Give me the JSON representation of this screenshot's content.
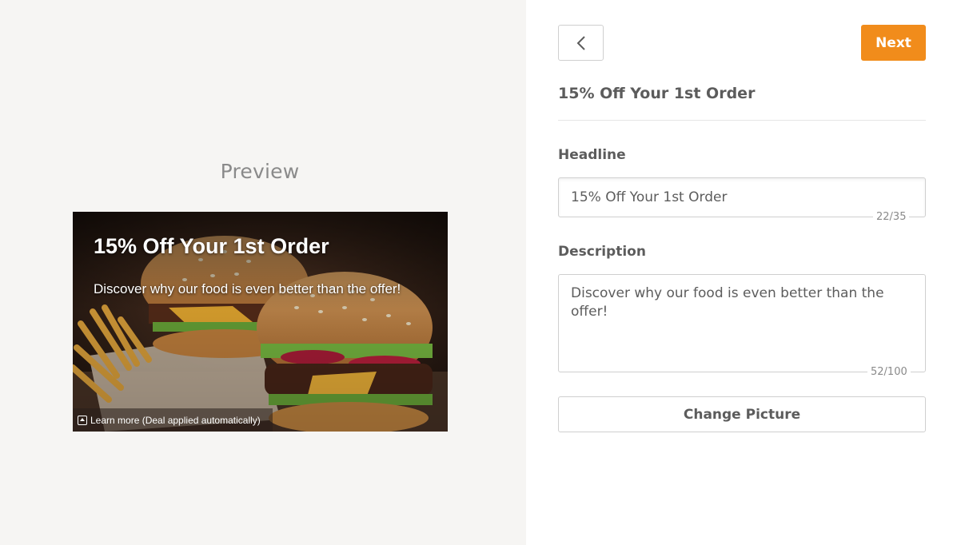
{
  "preview": {
    "title": "Preview",
    "ad": {
      "headline": "15% Off Your 1st Order",
      "description": "Discover why our food is even better than the offer!",
      "cta_label": "Learn more (Deal applied automatically)",
      "cta_icon": "arrow-up-box-icon",
      "image": "burgers-and-fries-photo"
    }
  },
  "toolbar": {
    "back_icon": "chevron-left-icon",
    "next_label": "Next",
    "accent_color": "#f18c1b"
  },
  "deal_title": "15% Off Your 1st Order",
  "form": {
    "headline": {
      "label": "Headline",
      "value": "15% Off Your 1st Order",
      "counter": "22/35"
    },
    "description": {
      "label": "Description",
      "value": "Discover why our food is even better than the offer!",
      "counter": "52/100"
    },
    "change_picture_label": "Change Picture"
  }
}
